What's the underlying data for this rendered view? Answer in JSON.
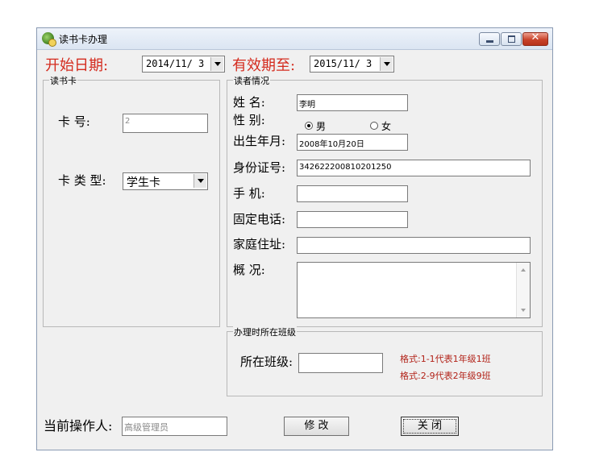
{
  "window": {
    "title": "读书卡办理",
    "close_glyph": "✕"
  },
  "dates": {
    "start_label": "开始日期:",
    "start_value": "2014/11/ 3",
    "end_label": "有效期至:",
    "end_value": "2015/11/ 3"
  },
  "card_group": {
    "title": "读书卡",
    "card_no_label": "卡  号:",
    "card_no_value": "2",
    "card_type_label": "卡 类 型:",
    "card_type_value": "学生卡"
  },
  "reader_group": {
    "title": "读者情况",
    "name_label": "姓  名:",
    "name_value": "李明",
    "gender_label": "性  别:",
    "gender_male": "男",
    "gender_female": "女",
    "gender_selected": "男",
    "birth_label": "出生年月:",
    "birth_value": "2008年10月20日",
    "id_label": "身份证号:",
    "id_value": "342622200810201250",
    "mobile_label": "手  机:",
    "mobile_value": "",
    "phone_label": "固定电话:",
    "phone_value": "",
    "address_label": "家庭住址:",
    "address_value": "",
    "summary_label": "概  况:",
    "summary_value": ""
  },
  "class_group": {
    "title": "办理时所在班级",
    "class_label": "所在班级:",
    "class_value": "",
    "hint1": "格式:1-1代表1年级1班",
    "hint2": "格式:2-9代表2年级9班"
  },
  "footer": {
    "operator_label": "当前操作人:",
    "operator_value": "高级管理员",
    "modify_button": "修 改",
    "close_button": "关 闭"
  },
  "colors": {
    "accent_red": "#d42b1e",
    "hint_red": "#b22218",
    "close_button": "#c8432b"
  }
}
